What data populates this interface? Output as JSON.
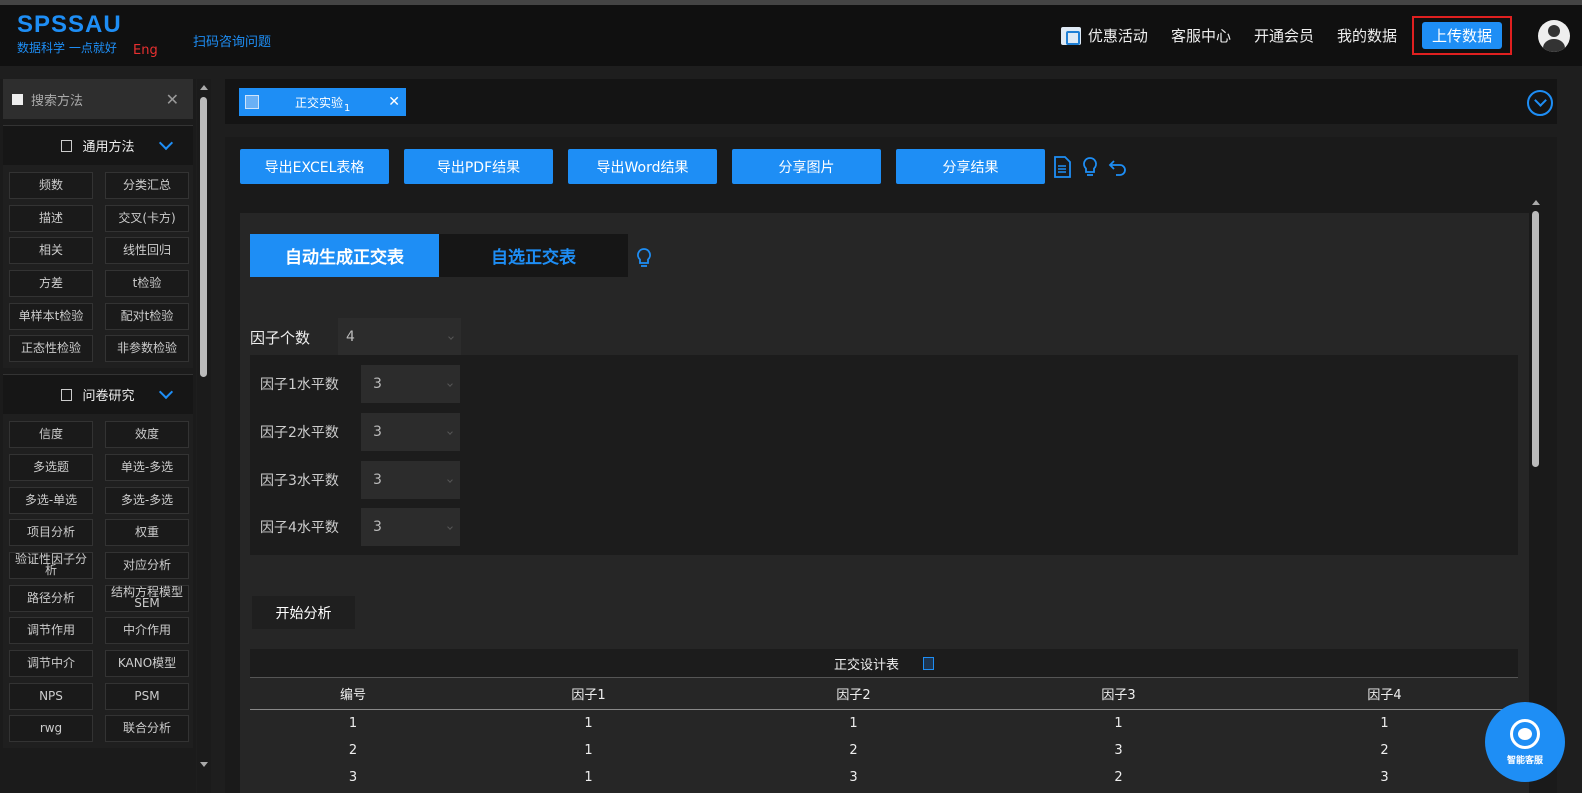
{
  "header": {
    "logo_main": "SPSSAU",
    "logo_sub": "数据科学 一点就好",
    "logo_eng": "Eng",
    "qr_link": "扫码咨询问题",
    "nav": {
      "promo": "优惠活动",
      "service": "客服中心",
      "member": "开通会员",
      "my_data": "我的数据",
      "upload": "上传数据"
    }
  },
  "sidebar": {
    "search_placeholder": "搜索方法",
    "sections": [
      {
        "title": "通用方法",
        "items": [
          "频数",
          "分类汇总",
          "描述",
          "交叉(卡方)",
          "相关",
          "线性回归",
          "方差",
          "t检验",
          "单样本t检验",
          "配对t检验",
          "正态性检验",
          "非参数检验"
        ]
      },
      {
        "title": "问卷研究",
        "items": [
          "信度",
          "效度",
          "多选题",
          "单选-多选",
          "多选-单选",
          "多选-多选",
          "项目分析",
          "权重",
          "验证性因子分析",
          "对应分析",
          "路径分析",
          "结构方程模型SEM",
          "调节作用",
          "中介作用",
          "调节中介",
          "KANO模型",
          "NPS",
          "PSM",
          "rwg",
          "联合分析"
        ]
      }
    ]
  },
  "tabs": [
    {
      "label": "正交实验",
      "count": "1"
    }
  ],
  "toolbar": {
    "export_excel": "导出EXCEL表格",
    "export_pdf": "导出PDF结果",
    "export_word": "导出Word结果",
    "share_image": "分享图片",
    "share_result": "分享结果"
  },
  "mode_tabs": {
    "auto": "自动生成正交表",
    "custom": "自选正交表"
  },
  "factor_count": {
    "label": "因子个数",
    "value": "4"
  },
  "levels": [
    {
      "label": "因子1水平数",
      "value": "3"
    },
    {
      "label": "因子2水平数",
      "value": "3"
    },
    {
      "label": "因子3水平数",
      "value": "3"
    },
    {
      "label": "因子4水平数",
      "value": "3"
    }
  ],
  "start_button": "开始分析",
  "design_table": {
    "title": "正交设计表",
    "headers": [
      "编号",
      "因子1",
      "因子2",
      "因子3",
      "因子4"
    ],
    "rows": [
      [
        "1",
        "1",
        "1",
        "1",
        "1"
      ],
      [
        "2",
        "1",
        "2",
        "3",
        "2"
      ],
      [
        "3",
        "1",
        "3",
        "2",
        "3"
      ]
    ]
  },
  "chat_widget": {
    "label": "智能客服"
  },
  "colors": {
    "accent": "#1e8ef5",
    "highlight_border": "#e02020",
    "background": "#1e1e1e"
  }
}
